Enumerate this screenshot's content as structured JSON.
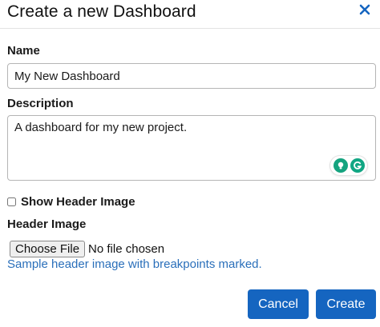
{
  "dialog": {
    "title": "Create a new Dashboard",
    "close_icon": "close-icon"
  },
  "form": {
    "name_label": "Name",
    "name_value": "My New Dashboard",
    "description_label": "Description",
    "description_value": "A dashboard for my new project.",
    "show_header_label": "Show Header Image",
    "show_header_checked": false,
    "header_image_label": "Header Image",
    "file_button_label": "Choose File",
    "file_status": "No file chosen",
    "sample_link": "Sample header image with breakpoints marked."
  },
  "footer": {
    "cancel_label": "Cancel",
    "create_label": "Create"
  },
  "colors": {
    "primary": "#1565c0",
    "link": "#2a6fba",
    "close_icon": "#1565c0",
    "grammarly_green": "#15a37f",
    "grammarly_teal": "#11a683"
  }
}
